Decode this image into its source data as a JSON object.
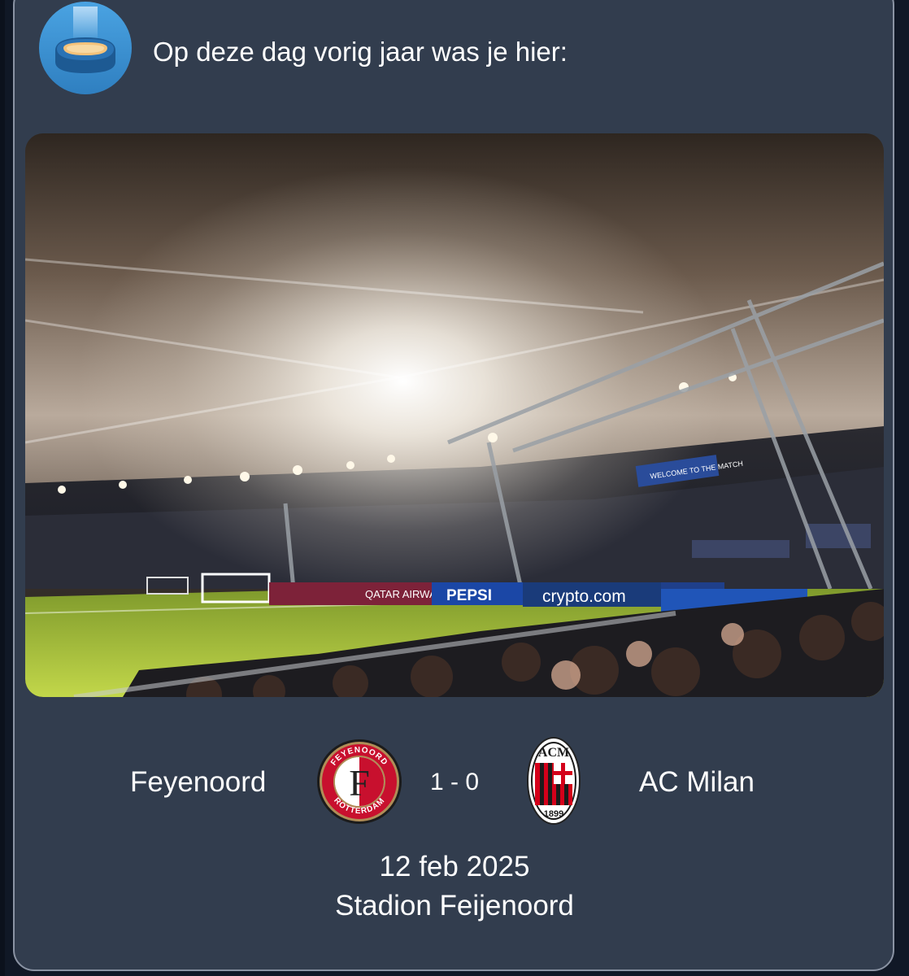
{
  "header": {
    "title": "Op deze dag vorig jaar was je hier:",
    "icon": "stadium-icon"
  },
  "photo": {
    "signage": {
      "sponsor_1": "QATAR AIRWAYS",
      "sponsor_2": "PEPSI",
      "sponsor_3": "crypto.com",
      "banner": "WELCOME TO THE MATCH"
    }
  },
  "match": {
    "home_team": "Feyenoord",
    "away_team": "AC Milan",
    "score": "1 - 0",
    "home_crest": {
      "text_top": "FEYENOORD",
      "text_bottom": "ROTTERDAM",
      "letter": "F"
    },
    "away_crest": {
      "text_top": "ACM",
      "text_bottom": "1899"
    },
    "date": "12 feb 2025",
    "venue": "Stadion Feijenoord"
  },
  "colors": {
    "card_bg": "#323d4e",
    "page_bg": "#101826",
    "icon_bg": "#3a8fd1",
    "pitch": "#a4c23a",
    "feyenoord_red": "#c8102e",
    "milan_red": "#d4001a"
  }
}
